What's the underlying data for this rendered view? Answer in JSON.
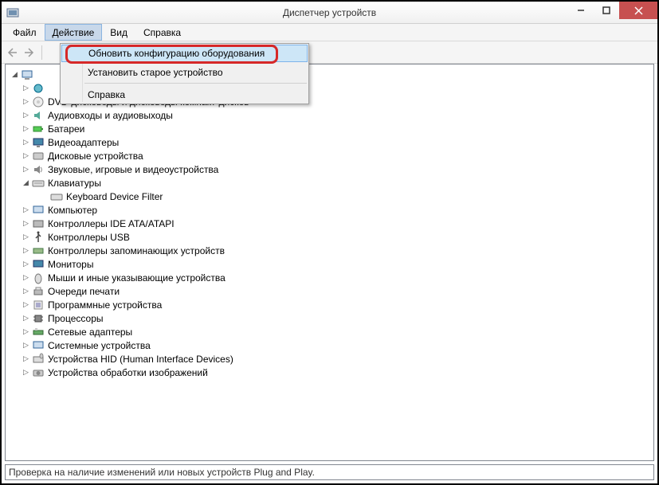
{
  "window": {
    "title": "Диспетчер устройств"
  },
  "menu": {
    "file": "Файл",
    "action": "Действие",
    "view": "Вид",
    "help": "Справка"
  },
  "dropdown": {
    "scan_hw": "Обновить конфигурацию оборудования",
    "add_legacy": "Установить старое устройство",
    "help": "Справка"
  },
  "tree": {
    "root": "",
    "dvd": "DVD-дисководы и дисководы компакт-дисков",
    "audio": "Аудиовходы и аудиовыходы",
    "batteries": "Батареи",
    "display": "Видеоадаптеры",
    "disk": "Дисковые устройства",
    "sound": "Звуковые, игровые и видеоустройства",
    "keyboards": "Клавиатуры",
    "keyboard_filter": "Keyboard Device Filter",
    "computer": "Компьютер",
    "ide": "Контроллеры IDE ATA/ATAPI",
    "usb": "Контроллеры USB",
    "storage_ctl": "Контроллеры запоминающих устройств",
    "monitors": "Мониторы",
    "mice": "Мыши и иные указывающие устройства",
    "print_queue": "Очереди печати",
    "software_dev": "Программные устройства",
    "processors": "Процессоры",
    "network": "Сетевые адаптеры",
    "system": "Системные устройства",
    "hid": "Устройства HID (Human Interface Devices)",
    "imaging": "Устройства обработки изображений"
  },
  "status": "Проверка на наличие изменений или новых устройств Plug and Play."
}
